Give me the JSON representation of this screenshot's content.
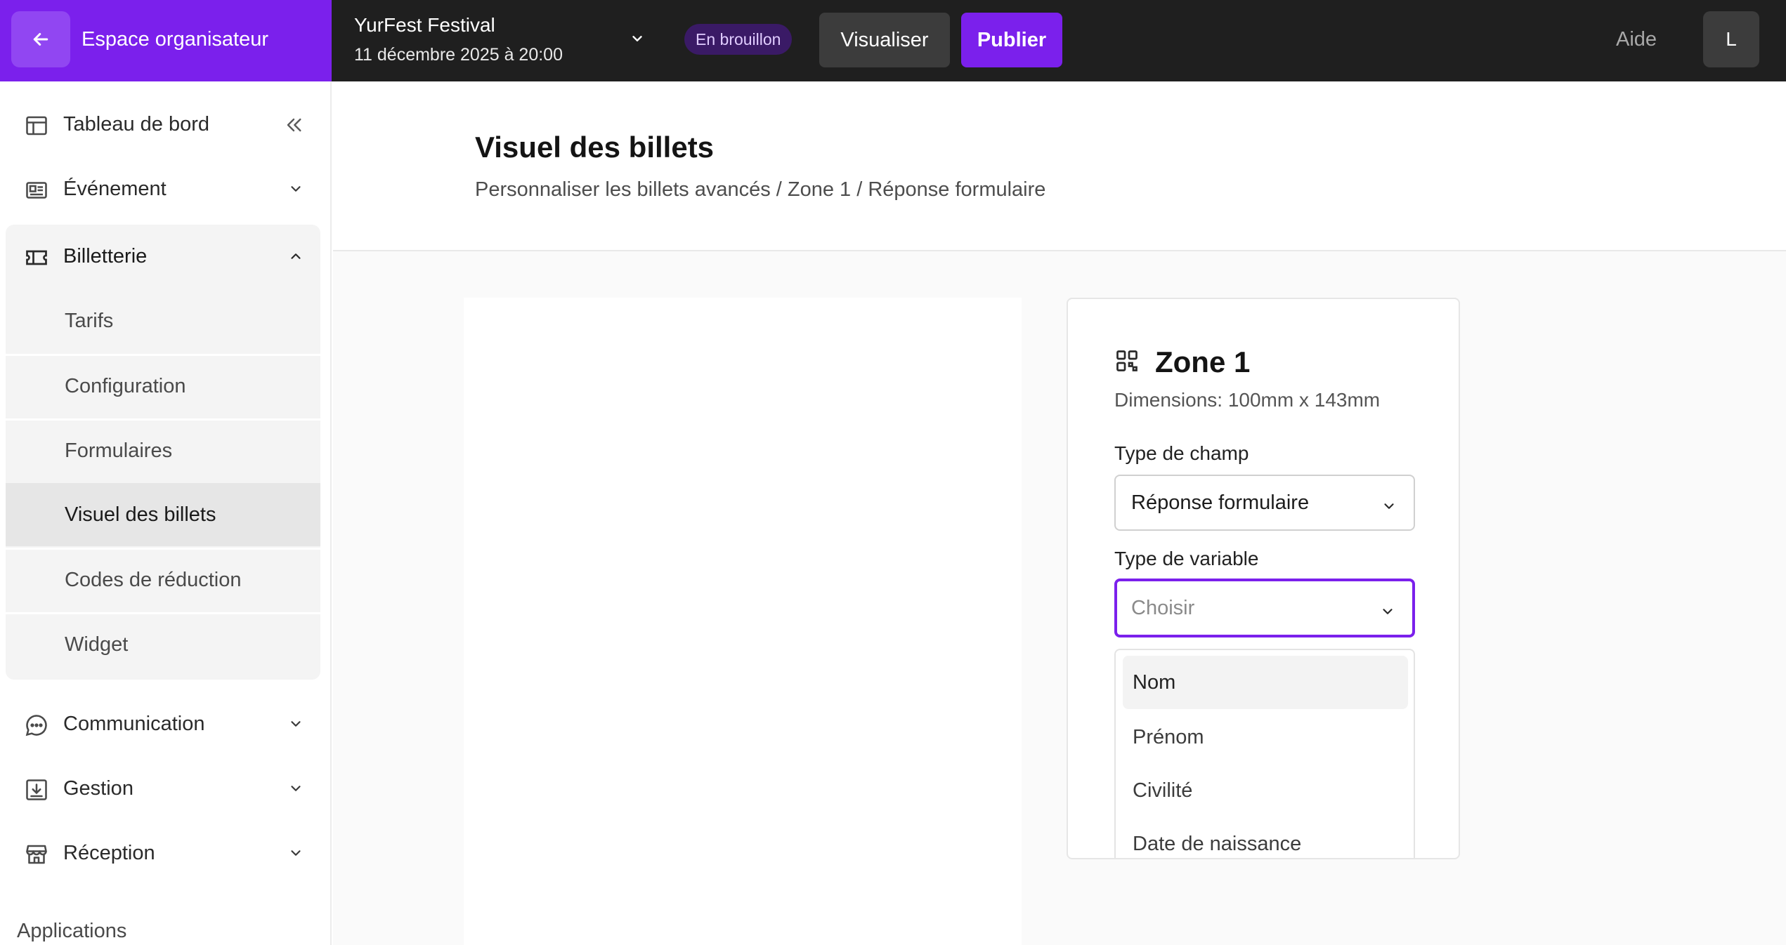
{
  "topbar": {
    "back_label": "Espace organisateur",
    "event_name": "YurFest Festival",
    "event_date": "11 décembre 2025 à 20:00",
    "status_badge": "En brouillon",
    "preview_label": "Visualiser",
    "publish_label": "Publier",
    "help_label": "Aide",
    "avatar_initial": "L"
  },
  "sidebar": {
    "dashboard": "Tableau de bord",
    "event": "Événement",
    "ticketing": "Billetterie",
    "ticketing_items": [
      "Tarifs",
      "Configuration",
      "Formulaires",
      "Visuel des billets",
      "Codes de réduction",
      "Widget"
    ],
    "communication": "Communication",
    "management": "Gestion",
    "reception": "Réception",
    "applications": "Applications"
  },
  "main": {
    "title": "Visuel des billets",
    "breadcrumb": "Personnaliser les billets avancés / Zone 1 / Réponse formulaire"
  },
  "zone": {
    "title": "Zone 1",
    "dimensions": "Dimensions: 100mm x 143mm",
    "field_type_label": "Type de champ",
    "field_type_value": "Réponse formulaire",
    "variable_type_label": "Type de variable",
    "variable_type_placeholder": "Choisir",
    "options": [
      "Nom",
      "Prénom",
      "Civilité",
      "Date de naissance"
    ]
  },
  "colors": {
    "accent": "#7b20ec",
    "topbar": "#1f1f1f",
    "badge_bg": "#3a1a66"
  }
}
